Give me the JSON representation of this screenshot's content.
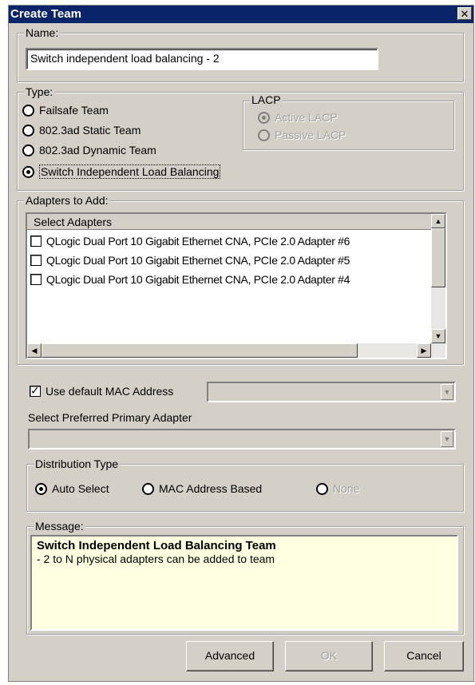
{
  "window": {
    "title": "Create Team",
    "close_glyph": "✕"
  },
  "name_group": {
    "legend": "Name:",
    "value": "Switch independent load balancing - 2"
  },
  "type_group": {
    "legend": "Type:",
    "options": [
      {
        "label": "Failsafe Team",
        "selected": false
      },
      {
        "label": "802.3ad Static Team",
        "selected": false
      },
      {
        "label": "802.3ad Dynamic Team",
        "selected": false
      },
      {
        "label": "Switch Independent Load Balancing",
        "selected": true
      }
    ]
  },
  "lacp_group": {
    "legend": "LACP",
    "enabled": false,
    "options": [
      {
        "label": "Active LACP",
        "selected": true
      },
      {
        "label": "Passive LACP",
        "selected": false
      }
    ]
  },
  "adapters_group": {
    "legend": "Adapters to Add:",
    "column_header": "Select Adapters",
    "items": [
      {
        "label": "QLogic Dual Port 10 Gigabit Ethernet CNA, PCIe 2.0 Adapter #6",
        "checked": false
      },
      {
        "label": "QLogic Dual Port 10 Gigabit Ethernet CNA, PCIe 2.0 Adapter #5",
        "checked": false
      },
      {
        "label": "QLogic Dual Port 10 Gigabit Ethernet CNA, PCIe 2.0 Adapter #4",
        "checked": false
      }
    ]
  },
  "mac": {
    "label": "Use default MAC Address",
    "checked": true,
    "value": ""
  },
  "primary_adapter": {
    "label": "Select Preferred Primary Adapter",
    "value": ""
  },
  "distribution_group": {
    "legend": "Distribution Type",
    "options": [
      {
        "label": "Auto Select",
        "selected": true,
        "enabled": true
      },
      {
        "label": "MAC Address Based",
        "selected": false,
        "enabled": true
      },
      {
        "label": "None",
        "selected": false,
        "enabled": false
      }
    ]
  },
  "message_group": {
    "legend": "Message:",
    "title": "Switch Independent Load Balancing Team",
    "body": "- 2 to N physical adapters can be added to team"
  },
  "buttons": {
    "advanced": "Advanced",
    "ok": "OK",
    "cancel": "Cancel"
  },
  "icons": {
    "close": "close-icon",
    "scroll_up": "arrow-up-icon",
    "scroll_down": "arrow-down-icon",
    "scroll_left": "arrow-left-icon",
    "scroll_right": "arrow-right-icon",
    "dropdown": "chevron-down-icon"
  }
}
